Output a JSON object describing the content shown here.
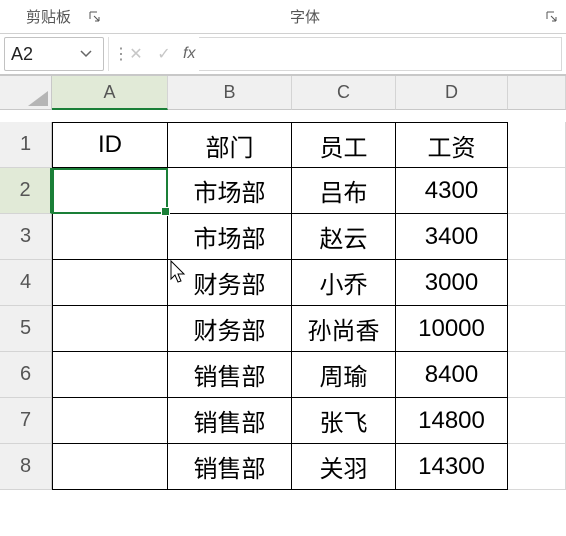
{
  "ribbon": {
    "group_clipboard": "剪贴板",
    "group_font": "字体"
  },
  "formula_bar": {
    "name_box": "A2",
    "cancel_glyph": "✕",
    "enter_glyph": "✓",
    "fx_label": "fx",
    "formula_value": ""
  },
  "columns": [
    "A",
    "B",
    "C",
    "D",
    ""
  ],
  "rows": [
    "1",
    "2",
    "3",
    "4",
    "5",
    "6",
    "7",
    "8"
  ],
  "selected_cell": "A2",
  "headers": {
    "A": "ID",
    "B": "部门",
    "C": "员工",
    "D": "工资"
  },
  "data": [
    {
      "A": "",
      "B": "市场部",
      "C": "吕布",
      "D": "4300"
    },
    {
      "A": "",
      "B": "市场部",
      "C": "赵云",
      "D": "3400"
    },
    {
      "A": "",
      "B": "财务部",
      "C": "小乔",
      "D": "3000"
    },
    {
      "A": "",
      "B": "财务部",
      "C": "孙尚香",
      "D": "10000"
    },
    {
      "A": "",
      "B": "销售部",
      "C": "周瑜",
      "D": "8400"
    },
    {
      "A": "",
      "B": "销售部",
      "C": "张飞",
      "D": "14800"
    },
    {
      "A": "",
      "B": "销售部",
      "C": "关羽",
      "D": "14300"
    }
  ]
}
